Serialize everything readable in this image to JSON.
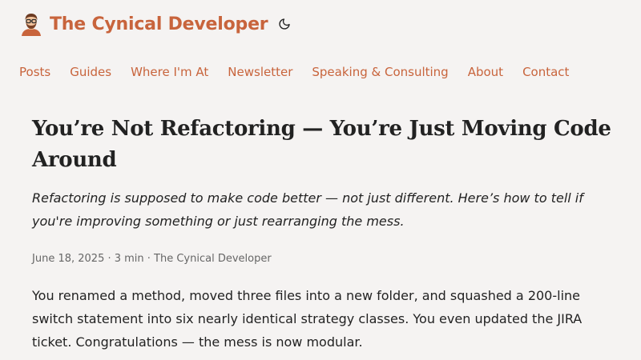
{
  "site": {
    "title": "The Cynical Developer",
    "avatar_icon": "developer-avatar-icon",
    "theme_toggle_icon": "moon-icon",
    "accent_color": "#c8643c",
    "background_color": "#f5f3f2"
  },
  "nav": {
    "items": [
      {
        "label": "Posts"
      },
      {
        "label": "Guides"
      },
      {
        "label": "Where I'm At"
      },
      {
        "label": "Newsletter"
      },
      {
        "label": "Speaking & Consulting"
      },
      {
        "label": "About"
      },
      {
        "label": "Contact"
      }
    ]
  },
  "post": {
    "title": "You’re Not Refactoring — You’re Just Moving Code Around",
    "subtitle": "Refactoring is supposed to make code better — not just different. Here’s how to tell if you're improving something or just rearranging the mess.",
    "meta": "June 18, 2025 · 3 min · The Cynical Developer",
    "body": [
      "You renamed a method, moved three files into a new folder, and squashed a 200-line switch statement into six nearly identical strategy classes. You even updated the JIRA ticket. Congratulations — the mess is now modular."
    ]
  }
}
